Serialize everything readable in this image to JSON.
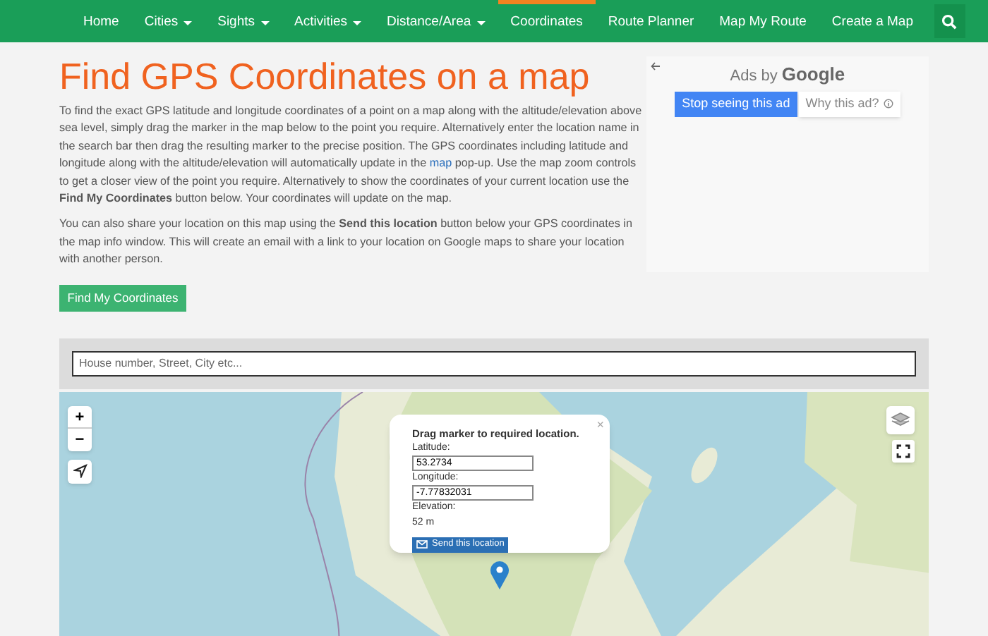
{
  "nav": {
    "items": [
      {
        "label": "Home",
        "menu": false,
        "selected": false
      },
      {
        "label": "Cities",
        "menu": true,
        "selected": false
      },
      {
        "label": "Sights",
        "menu": true,
        "selected": false
      },
      {
        "label": "Activities",
        "menu": true,
        "selected": false
      },
      {
        "label": "Distance/Area",
        "menu": true,
        "selected": false
      },
      {
        "label": "Coordinates",
        "menu": false,
        "selected": true
      },
      {
        "label": "Route Planner",
        "menu": false,
        "selected": false
      },
      {
        "label": "Map My Route",
        "menu": false,
        "selected": false
      },
      {
        "label": "Create a Map",
        "menu": false,
        "selected": false
      }
    ]
  },
  "title": "Find GPS Coordinates on a map",
  "paragraphs": [
    [
      {
        "kind": "text",
        "text": "To find the exact GPS latitude and longitude coordinates of a point on a map along with the altitude/elevation above sea level, simply drag the marker in the map below to the point you require. Alternatively enter the location name in the search bar then drag the resulting marker to the precise position. The GPS coordinates including latitude and longitude along with the altitude/elevation will automatically update in the "
      },
      {
        "kind": "link",
        "text": "map"
      },
      {
        "kind": "text",
        "text": " pop-up. Use the map zoom controls to get a closer view of the point you require. Alternatively to show the coordinates of your current location use the **Find My Coordinates** button below. Your coordinates will update on the map."
      }
    ],
    [
      {
        "kind": "text",
        "text": "You can also share your location on this map using the **Send this location** button below your GPS coordinates in the map info window. This will create an email with a link to your location on Google maps to share your location with another person."
      }
    ]
  ],
  "find_button": "Find My Coordinates",
  "ad": {
    "ads_by": "Ads by",
    "brand": "Google",
    "stop_button": "Stop seeing this ad",
    "why_button": "Why this ad?"
  },
  "search": {
    "placeholder": "House number, Street, City etc..."
  },
  "map": {
    "zoom_in": "+",
    "zoom_out": "−",
    "popup": {
      "close": "×",
      "heading": "Drag marker to required location.",
      "latitude_label": "Latitude:",
      "latitude": "53.2734",
      "longitude_label": "Longitude:",
      "longitude": "-7.77832031",
      "elevation_label": "Elevation:",
      "elevation": "52 m",
      "send_button": "Send this location"
    }
  }
}
